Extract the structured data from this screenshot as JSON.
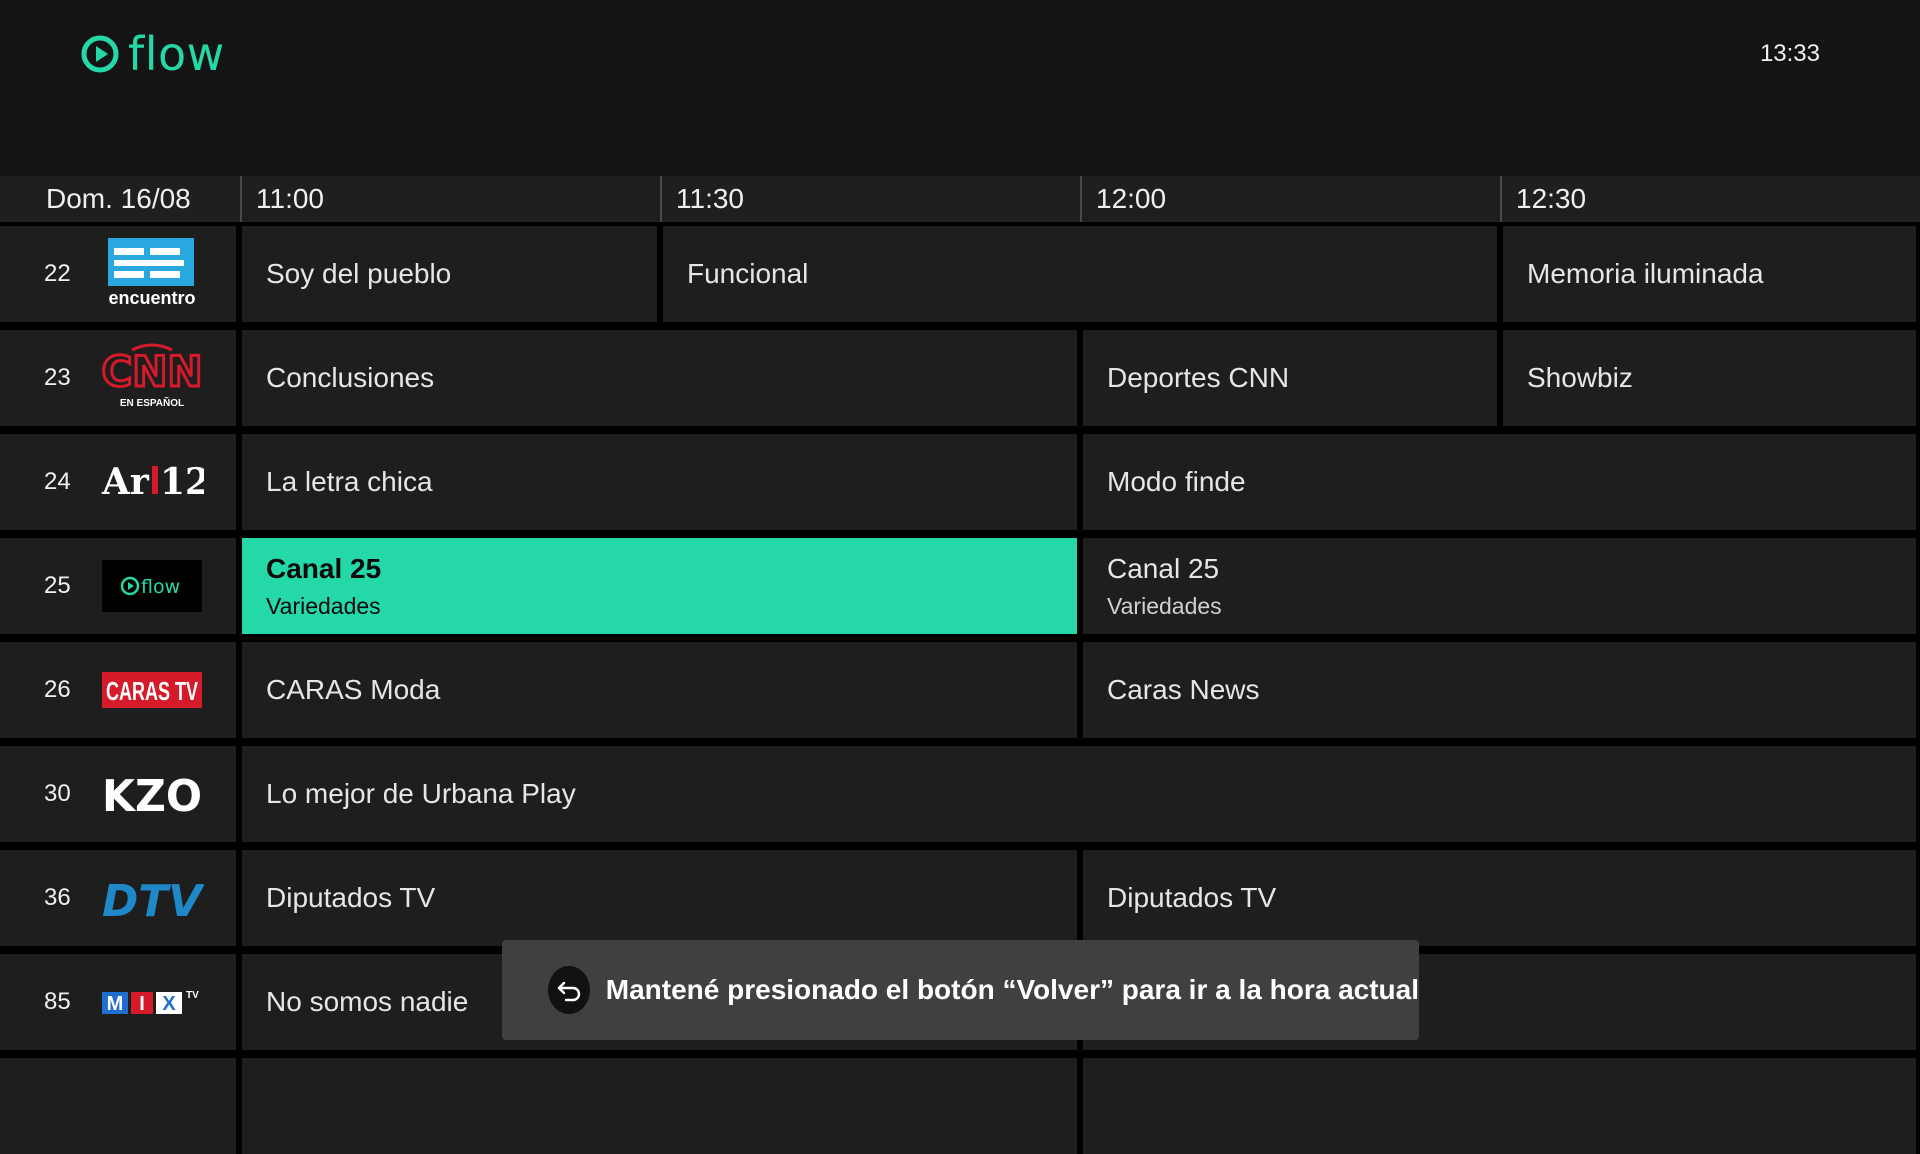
{
  "app": {
    "brand": "flow",
    "time": "13:33",
    "accent": "#25d8a8"
  },
  "timebar": {
    "date": "Dom. 16/08",
    "slots": [
      "11:00",
      "11:30",
      "12:00",
      "12:30"
    ]
  },
  "channels": [
    {
      "number": "22",
      "logo": "encuentro",
      "logo_text": "encuentro",
      "programs": [
        {
          "title": "Soy del pueblo"
        },
        {
          "title": "Funcional"
        },
        {
          "title": "Memoria iluminada"
        }
      ]
    },
    {
      "number": "23",
      "logo": "cnn-en-espanol",
      "logo_text": "CNN EN ESPAÑOL",
      "programs": [
        {
          "title": "Conclusiones"
        },
        {
          "title": "Deportes CNN"
        },
        {
          "title": "Showbiz"
        }
      ]
    },
    {
      "number": "24",
      "logo": "ar12",
      "logo_text": "Ar12",
      "programs": [
        {
          "title": "La letra chica"
        },
        {
          "title": "Modo finde"
        }
      ]
    },
    {
      "number": "25",
      "logo": "flow",
      "logo_text": "flow",
      "programs": [
        {
          "title": "Canal 25",
          "subtitle": "Variedades",
          "selected": true
        },
        {
          "title": "Canal 25",
          "subtitle": "Variedades"
        }
      ]
    },
    {
      "number": "26",
      "logo": "caras-tv",
      "logo_text": "CARAS TV",
      "programs": [
        {
          "title": "CARAS Moda"
        },
        {
          "title": "Caras News"
        }
      ]
    },
    {
      "number": "30",
      "logo": "kzo",
      "logo_text": "KZO",
      "programs": [
        {
          "title": "Lo mejor de Urbana Play"
        }
      ]
    },
    {
      "number": "36",
      "logo": "dtv",
      "logo_text": "DTV",
      "programs": [
        {
          "title": "Diputados TV"
        },
        {
          "title": "Diputados TV"
        }
      ]
    },
    {
      "number": "85",
      "logo": "mix-tv",
      "logo_text": "MIX TV",
      "programs": [
        {
          "title": "No somos nadie"
        },
        {
          "title": ""
        }
      ]
    }
  ],
  "toast": {
    "icon": "back-arrow-icon",
    "message": "Mantené presionado el botón “Volver” para ir a la hora actual"
  }
}
